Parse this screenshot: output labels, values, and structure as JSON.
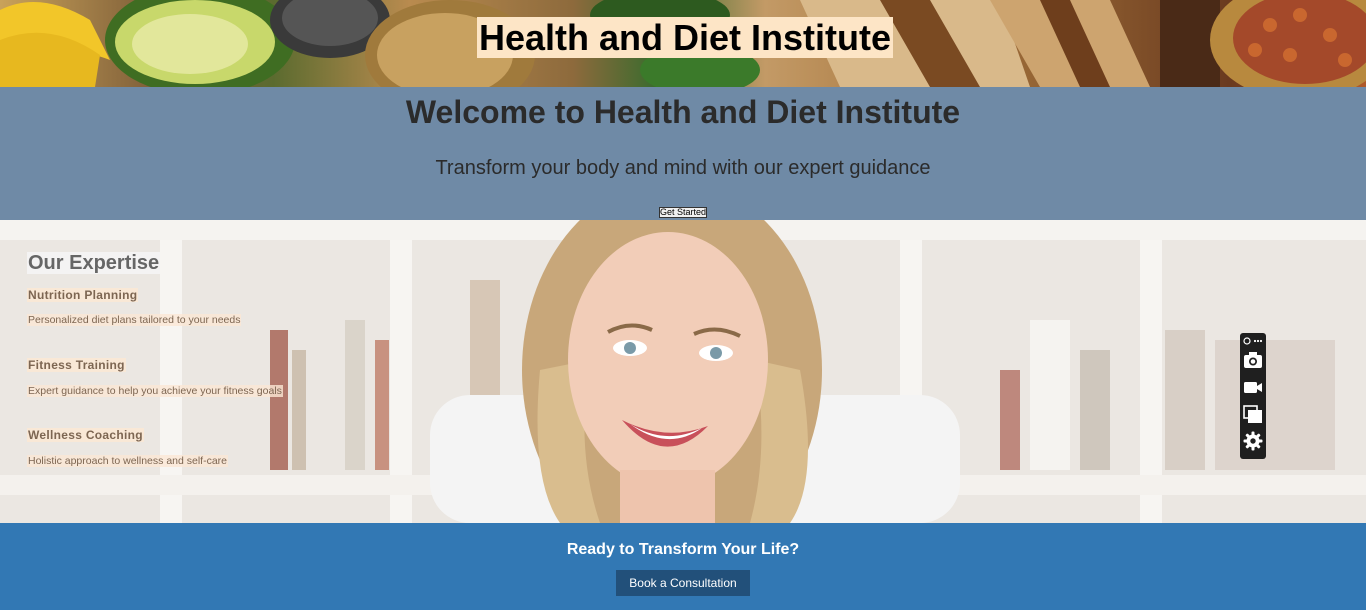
{
  "header": {
    "title": "Health and Diet Institute",
    "image_alt": "food-ingredients-photo"
  },
  "hero": {
    "heading": "Welcome to Health and Diet Institute",
    "tagline": "Transform your body and mind with our expert guidance",
    "cta_label": "Get Started"
  },
  "expertise": {
    "title": "Our Expertise",
    "image_alt": "smiling-woman-photo",
    "services": [
      {
        "title": "Nutrition Planning",
        "description": "Personalized diet plans tailored to your needs"
      },
      {
        "title": "Fitness Training",
        "description": "Expert guidance to help you achieve your fitness goals"
      },
      {
        "title": "Wellness Coaching",
        "description": "Holistic approach to wellness and self-care"
      }
    ]
  },
  "toolbar": {
    "icons": [
      "rocket-icon",
      "more-icon",
      "camera-icon",
      "video-icon",
      "copy-icon",
      "gear-icon"
    ]
  },
  "cta": {
    "heading": "Ready to Transform Your Life?",
    "button_label": "Book a Consultation"
  },
  "colors": {
    "hero_bg": "#6f8aa6",
    "cta_bg": "#3278b4",
    "cta_button_bg": "#22507a",
    "title_highlight": "#fde5c6"
  }
}
